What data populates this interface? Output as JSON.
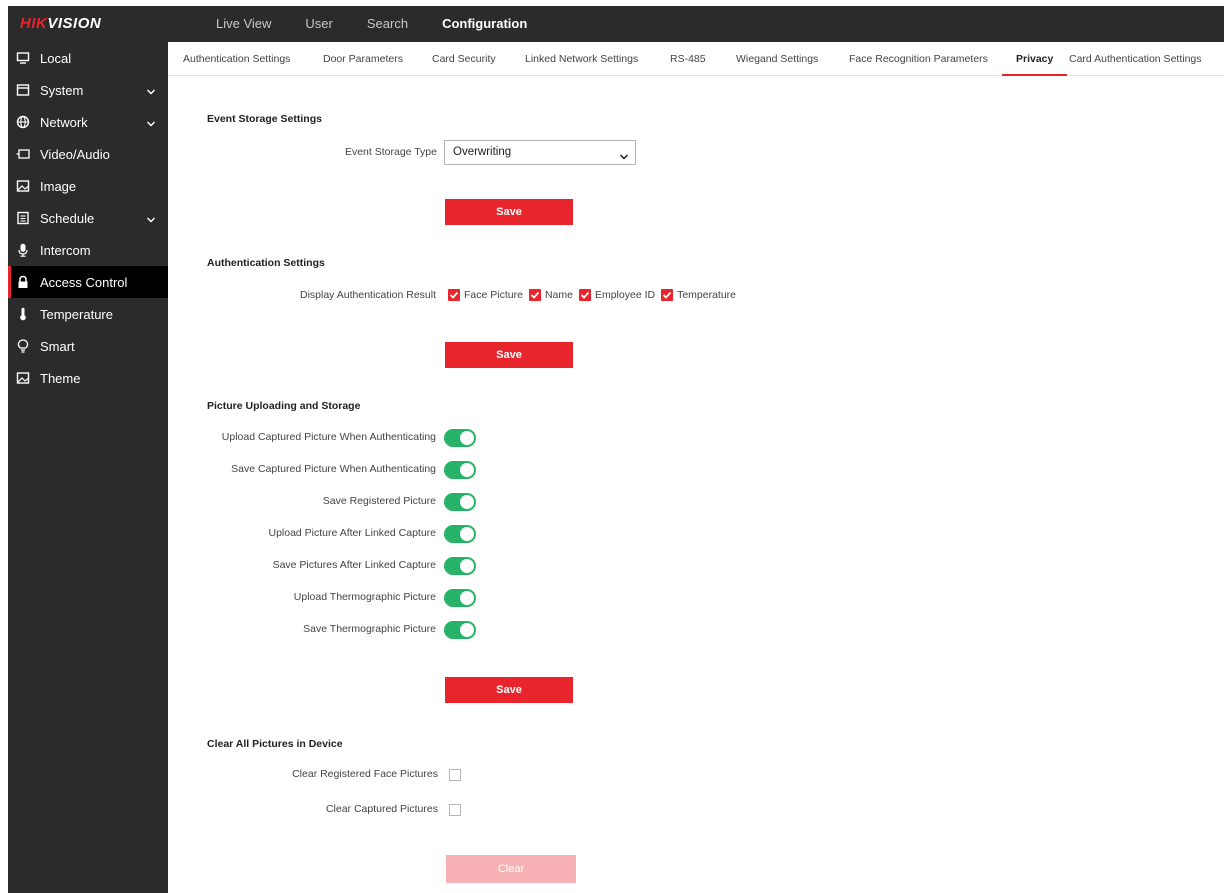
{
  "brand": {
    "logo_red": "HIK",
    "logo_white": "VISION"
  },
  "top_nav": [
    {
      "label": "Live View"
    },
    {
      "label": "User"
    },
    {
      "label": "Search"
    },
    {
      "label": "Configuration",
      "active": true
    }
  ],
  "sidebar": {
    "items": [
      {
        "label": "Local",
        "icon": "monitor-icon"
      },
      {
        "label": "System",
        "icon": "system-window-icon",
        "expandable": true
      },
      {
        "label": "Network",
        "icon": "globe-icon",
        "expandable": true
      },
      {
        "label": "Video/Audio",
        "icon": "video-audio-icon"
      },
      {
        "label": "Image",
        "icon": "image-icon"
      },
      {
        "label": "Schedule",
        "icon": "schedule-icon",
        "expandable": true
      },
      {
        "label": "Intercom",
        "icon": "microphone-icon"
      },
      {
        "label": "Access Control",
        "icon": "lock-icon",
        "active": true
      },
      {
        "label": "Temperature",
        "icon": "thermometer-icon"
      },
      {
        "label": "Smart",
        "icon": "lightbulb-icon"
      },
      {
        "label": "Theme",
        "icon": "theme-icon"
      }
    ]
  },
  "tabs": [
    {
      "label": "Authentication Settings"
    },
    {
      "label": "Door Parameters"
    },
    {
      "label": "Card Security"
    },
    {
      "label": "Linked Network Settings"
    },
    {
      "label": "RS-485"
    },
    {
      "label": "Wiegand Settings"
    },
    {
      "label": "Face Recognition Parameters"
    },
    {
      "label": "Privacy",
      "active": true
    },
    {
      "label": "Card Authentication Settings"
    }
  ],
  "event_storage": {
    "title": "Event Storage Settings",
    "type_label": "Event Storage Type",
    "type_value": "Overwriting",
    "save_label": "Save"
  },
  "authentication": {
    "title": "Authentication Settings",
    "display_label": "Display Authentication Result",
    "options": [
      {
        "label": "Face Picture",
        "checked": true
      },
      {
        "label": "Name",
        "checked": true
      },
      {
        "label": "Employee ID",
        "checked": true
      },
      {
        "label": "Temperature",
        "checked": true
      }
    ],
    "save_label": "Save"
  },
  "picture_upload": {
    "title": "Picture Uploading and Storage",
    "toggles": [
      {
        "label": "Upload Captured Picture When Authenticating",
        "on": true
      },
      {
        "label": "Save Captured Picture When Authenticating",
        "on": true
      },
      {
        "label": "Save Registered Picture",
        "on": true
      },
      {
        "label": "Upload Picture After Linked Capture",
        "on": true
      },
      {
        "label": "Save Pictures After Linked Capture",
        "on": true
      },
      {
        "label": "Upload Thermographic Picture",
        "on": true
      },
      {
        "label": "Save Thermographic Picture",
        "on": true
      }
    ],
    "save_label": "Save"
  },
  "clear_pictures": {
    "title": "Clear All Pictures in Device",
    "options": [
      {
        "label": "Clear Registered Face Pictures",
        "checked": false
      },
      {
        "label": "Clear Captured Pictures",
        "checked": false
      }
    ],
    "clear_label": "Clear"
  },
  "colors": {
    "accent": "#e8252d",
    "toggle_on": "#27b368",
    "sidebar_bg": "#2b2b2b"
  }
}
